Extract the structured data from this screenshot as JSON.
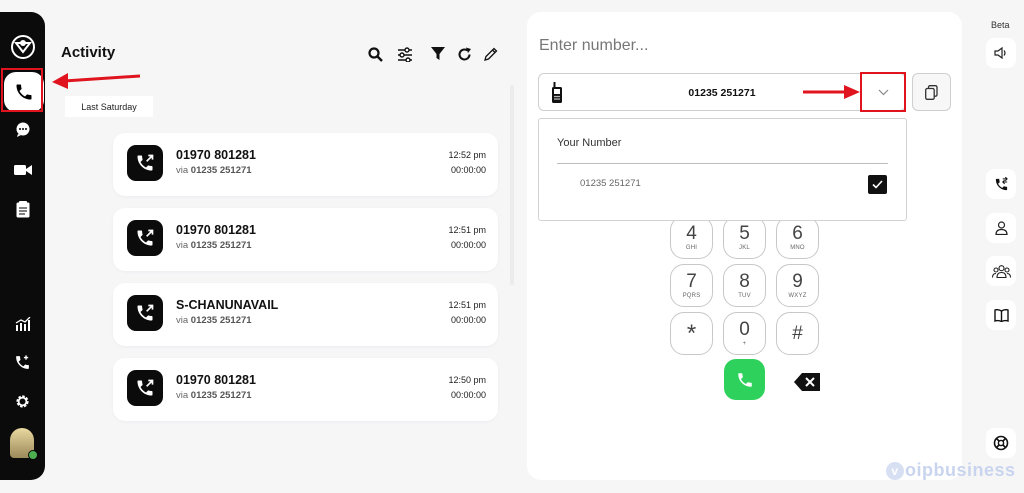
{
  "activity": {
    "title": "Activity",
    "date_group": "Last Saturday",
    "calls": [
      {
        "number": "01970 801281",
        "via_prefix": "via",
        "via_number": "01235 251271",
        "time": "12:52 pm",
        "duration": "00:00:00"
      },
      {
        "number": "01970 801281",
        "via_prefix": "via",
        "via_number": "01235 251271",
        "time": "12:51 pm",
        "duration": "00:00:00"
      },
      {
        "number": "S-CHANUNAVAIL",
        "via_prefix": "via",
        "via_number": "01235 251271",
        "time": "12:51 pm",
        "duration": "00:00:00"
      },
      {
        "number": "01970 801281",
        "via_prefix": "via",
        "via_number": "01235 251271",
        "time": "12:50 pm",
        "duration": "00:00:00"
      }
    ]
  },
  "dialer": {
    "placeholder": "Enter number...",
    "selected_number": "01235 251271",
    "dropdown": {
      "header": "Your Number",
      "options": [
        {
          "number": "01235 251271",
          "checked": true
        }
      ]
    },
    "keys": [
      {
        "digit": "4",
        "letters": "GHI"
      },
      {
        "digit": "5",
        "letters": "JKL"
      },
      {
        "digit": "6",
        "letters": "MNO"
      },
      {
        "digit": "7",
        "letters": "PQRS"
      },
      {
        "digit": "8",
        "letters": "TUV"
      },
      {
        "digit": "9",
        "letters": "WXYZ"
      },
      {
        "digit": "*",
        "letters": ""
      },
      {
        "digit": "0",
        "letters": "+"
      },
      {
        "digit": "#",
        "letters": ""
      }
    ]
  },
  "right_rail": {
    "beta_label": "Beta"
  },
  "watermark": {
    "prefix": "v",
    "text": "oipbusiness"
  },
  "colors": {
    "nav_bg": "#0b0b0b",
    "annotation_red": "#e0141e",
    "call_green": "#2fd15d"
  },
  "icons": [
    "logo-icon",
    "phone-icon",
    "chat-icon",
    "video-icon",
    "notes-icon",
    "analytics-icon",
    "phone-add-icon",
    "settings-icon",
    "search-icon",
    "sliders-icon",
    "filter-icon",
    "refresh-icon",
    "pencil-icon",
    "mobile-phone-icon",
    "chevron-down-icon",
    "copy-icon",
    "check-icon",
    "backspace-icon",
    "speaker-icon",
    "call-transfer-icon",
    "user-icon",
    "group-icon",
    "book-icon",
    "help-icon"
  ]
}
